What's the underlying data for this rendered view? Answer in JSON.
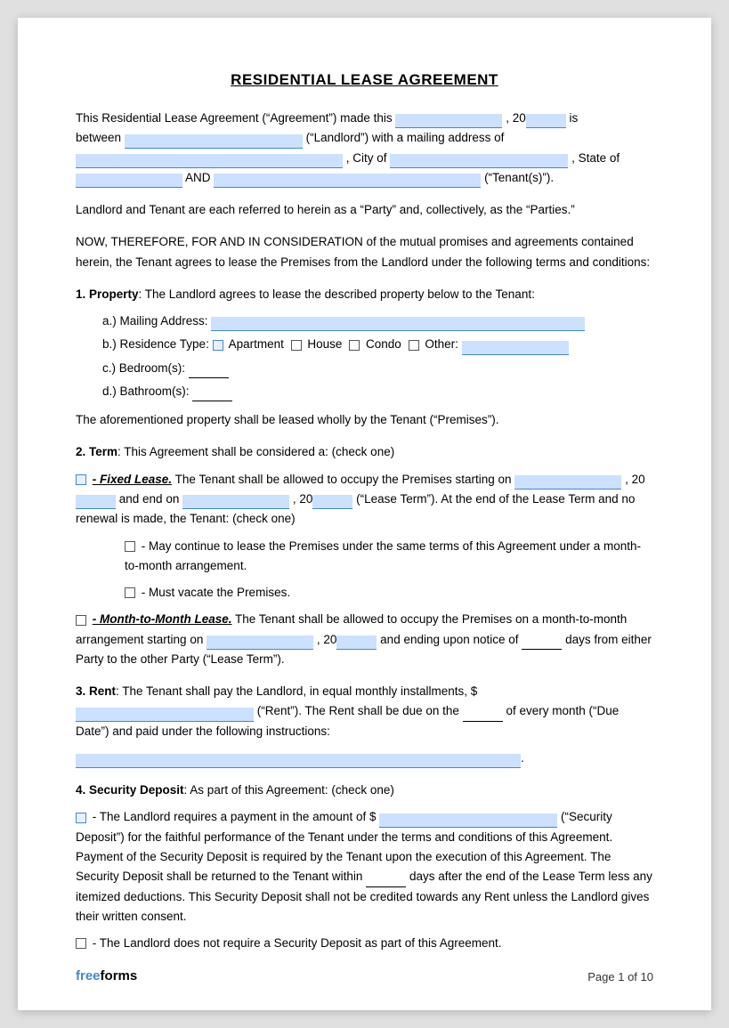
{
  "title": "RESIDENTIAL LEASE AGREEMENT",
  "intro": {
    "line1": "This Residential Lease Agreement (“Agreement”) made this",
    "line1b": ", 20",
    "line1c": "is",
    "line2": "between",
    "line2b": "(“Landlord”) with a mailing address of",
    "line3b": ", City of",
    "line3c": ", State of",
    "line4": "AND",
    "line4b": "(“Tenant(s)”)."
  },
  "party_note": "Landlord and Tenant are each referred to herein as a “Party” and, collectively, as the “Parties.”",
  "consideration": "NOW, THEREFORE, FOR AND IN CONSIDERATION of the mutual promises and agreements contained herein, the Tenant agrees to lease the Premises from the Landlord under the following terms and conditions:",
  "section1": {
    "heading": "1. Property",
    "text": ": The Landlord agrees to lease the described property below to the Tenant:",
    "a_label": "a.)  Mailing Address:",
    "b_label": "b.)  Residence Type:",
    "b_apartment": "Apartment",
    "b_house": "House",
    "b_condo": "Condo",
    "b_other": "Other:",
    "c_label": "c.)  Bedroom(s):",
    "d_label": "d.)  Bathroom(s):",
    "closing": "The aforementioned property shall be leased wholly by the Tenant (“Premises”)."
  },
  "section2": {
    "heading": "2. Term",
    "text": ": This Agreement shall be considered a: (check one)",
    "fixed_label": "- Fixed Lease.",
    "fixed_text1": "The Tenant shall be allowed to occupy the Premises starting on",
    "fixed_text2": ", 20",
    "fixed_text3": "and end on",
    "fixed_text4": ", 20",
    "fixed_text5": "(“Lease Term”). At the end of the Lease Term and no renewal is made, the Tenant: (check one)",
    "option1": "- May continue to lease the Premises under the same terms of this Agreement under a month-to-month arrangement.",
    "option2": "- Must vacate the Premises.",
    "month_label": "- Month-to-Month Lease.",
    "month_text1": "The Tenant shall be allowed to occupy the Premises on a month-to-month arrangement starting on",
    "month_text2": ", 20",
    "month_text3": "and ending upon notice of",
    "month_text4": "days from either Party to the other Party (“Lease Term”)."
  },
  "section3": {
    "heading": "3. Rent",
    "text1": ": The Tenant shall pay the Landlord, in equal monthly installments, $",
    "text2": "(“Rent”). The Rent shall be due on the",
    "text3": "of every month (“Due Date”) and paid under the following instructions:",
    "text4": "."
  },
  "section4": {
    "heading": "4. Security Deposit",
    "text": ": As part of this Agreement: (check one)",
    "option1_text1": "- The Landlord requires a payment in the amount of $",
    "option1_text2": "(“Security Deposit”) for the faithful performance of the Tenant under the terms and conditions of this Agreement. Payment of the Security Deposit is required by the Tenant upon the execution of this Agreement. The Security Deposit shall be returned to the Tenant within",
    "option1_text3": "days after the end of the Lease Term less any itemized deductions. This Security Deposit shall not be credited towards any Rent unless the Landlord gives their written consent.",
    "option2_text": "- The Landlord does not require a Security Deposit as part of this Agreement."
  },
  "footer": {
    "brand_free": "free",
    "brand_forms": "forms",
    "page": "Page 1 of 10"
  }
}
